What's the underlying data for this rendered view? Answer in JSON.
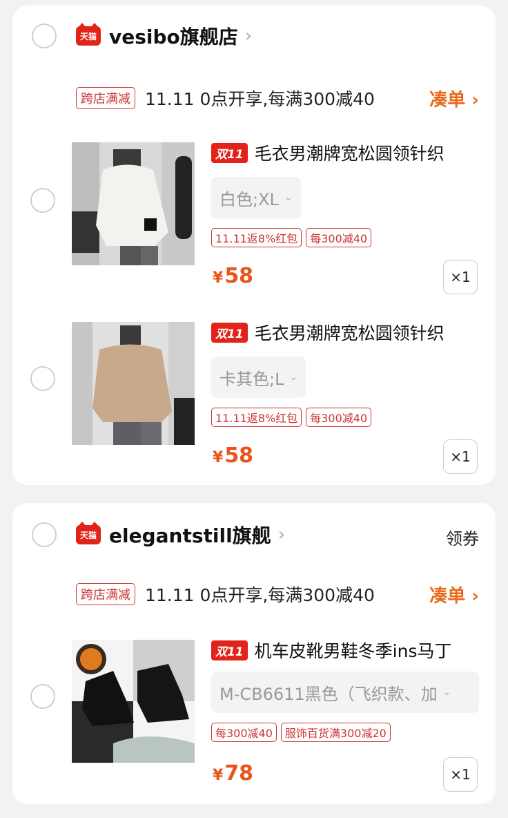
{
  "shops": [
    {
      "logo": "天猫",
      "name": "vesibo旗舰店",
      "chevron": "›",
      "coupon": "",
      "promo": {
        "tag": "跨店满减",
        "text": "11.11 0点开享,每满300减40",
        "link": "凑单 ›"
      },
      "items": [
        {
          "badge": "双11",
          "title": "毛衣男潮牌宽松圆领针织",
          "sku": "白色;XL",
          "tags": [
            "11.11返8%红包",
            "每300减40"
          ],
          "yen": "¥",
          "price": "58",
          "qty": "×1",
          "image": "white-sweater-photo"
        },
        {
          "badge": "双11",
          "title": "毛衣男潮牌宽松圆领针织",
          "sku": "卡其色;L",
          "tags": [
            "11.11返8%红包",
            "每300减40"
          ],
          "yen": "¥",
          "price": "58",
          "qty": "×1",
          "image": "khaki-sweater-photo"
        }
      ]
    },
    {
      "logo": "天猫",
      "name": "elegantstill旗舰",
      "chevron": "›",
      "coupon": "领券",
      "promo": {
        "tag": "跨店满减",
        "text": "11.11 0点开享,每满300减40",
        "link": "凑单 ›"
      },
      "items": [
        {
          "badge": "双11",
          "title": "机车皮靴男鞋冬季ins马丁",
          "sku": "M-CB6611黑色（飞织款、加",
          "tags": [
            "每300减40",
            "服饰百货满300减20"
          ],
          "yen": "¥",
          "price": "78",
          "qty": "×1",
          "image": "black-boots-photo"
        }
      ]
    }
  ],
  "icons": {
    "dropdown": "chevron-down-icon",
    "chevron": "chevron-right-icon"
  },
  "colors": {
    "accent": "#e8541a",
    "tmall": "#e2231a",
    "tag": "#cc3333"
  }
}
